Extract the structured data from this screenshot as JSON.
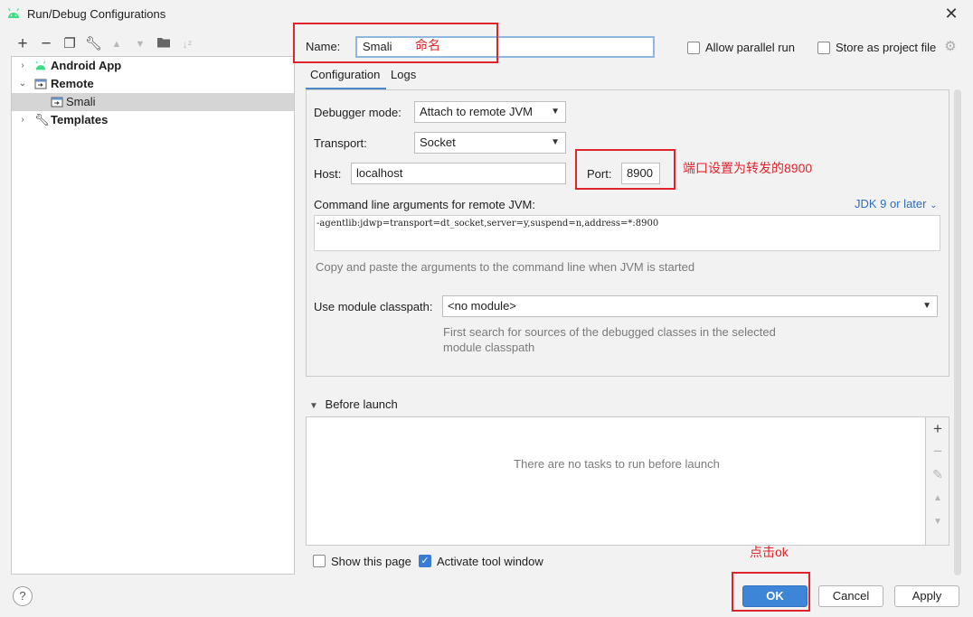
{
  "window": {
    "title": "Run/Debug Configurations"
  },
  "toolbar": {
    "icons": [
      "add-icon",
      "remove-icon",
      "copy-icon",
      "wrench-icon",
      "move-up-icon",
      "move-down-icon",
      "folder-icon",
      "sort-icon"
    ]
  },
  "tree": {
    "items": [
      {
        "label": "Android App",
        "expanded": false
      },
      {
        "label": "Remote",
        "expanded": true
      },
      {
        "label": "Smali",
        "selected": true
      },
      {
        "label": "Templates",
        "expanded": false
      }
    ]
  },
  "name": {
    "label": "Name:",
    "value": "Smali"
  },
  "options": {
    "allow_parallel": {
      "label": "Allow parallel run",
      "checked": false
    },
    "store_project": {
      "label": "Store as project file",
      "checked": false
    }
  },
  "tabs": [
    {
      "label": "Configuration",
      "active": true
    },
    {
      "label": "Logs",
      "active": false
    }
  ],
  "config": {
    "debugger_mode": {
      "label": "Debugger mode:",
      "value": "Attach to remote JVM"
    },
    "transport": {
      "label": "Transport:",
      "value": "Socket"
    },
    "host": {
      "label": "Host:",
      "value": "localhost"
    },
    "port": {
      "label": "Port:",
      "value": "8900"
    },
    "cmdline": {
      "label": "Command line arguments for remote JVM:",
      "jdk_link": "JDK 9 or later",
      "value": "-agentlib:jdwp=transport=dt_socket,server=y,suspend=n,address=*:8900",
      "hint": "Copy and paste the arguments to the command line when JVM is started"
    },
    "module_classpath": {
      "label": "Use module classpath:",
      "value": "<no module>",
      "hint_line1": "First search for sources of the debugged classes in the selected",
      "hint_line2": "module classpath"
    }
  },
  "before_launch": {
    "header": "Before launch",
    "empty_text": "There are no tasks to run before launch"
  },
  "bottom": {
    "show_page": {
      "label": "Show this page",
      "checked": false
    },
    "activate_tool": {
      "label": "Activate tool window",
      "checked": true
    },
    "help": "?",
    "ok": "OK",
    "cancel": "Cancel",
    "apply": "Apply"
  },
  "annotations": {
    "name_note": "命名",
    "port_note": "端口设置为转发的8900",
    "ok_note": "点击ok"
  },
  "colors": {
    "accent": "#3d85d6",
    "annotation": "#e0242b",
    "android": "#3ddc84"
  }
}
